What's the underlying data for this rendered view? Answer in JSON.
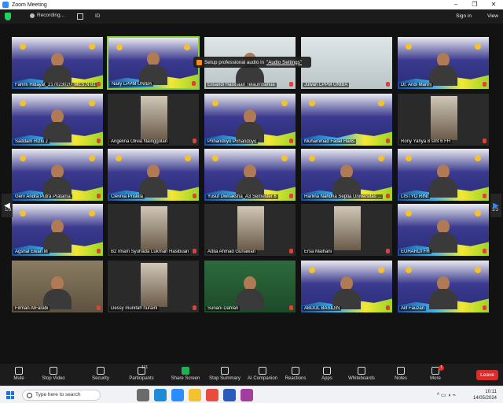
{
  "window": {
    "title": "Zoom Meeting",
    "controls": [
      "–",
      "❐",
      "✕"
    ]
  },
  "topbar": {
    "recording": "Recording...",
    "meeting_id_label": "ID",
    "signin": "Sign in",
    "view": "View"
  },
  "toast": {
    "text": "Setup professional audio in ",
    "link": "\"Audio Settings\""
  },
  "pagination": {
    "left": "1/3",
    "right": "1/3"
  },
  "participants": [
    "Fahmi Hidayat_217023020_MES.N 81",
    "Naily LPPM UNIBA",
    "Elisandi Hasloaan Telaumbanua",
    "Juwari LPPM UNIBA",
    "Dr. Andi Marini",
    "Saddam Rizki J",
    "Angelina Olivia Nainggolan",
    "Prihandoyo Prihandoyo",
    "Muhammad Fadel Haris",
    "Rony Yahya 8 smt 6 FH",
    "Gerv Andra Putra Pratama",
    "Clevnia Priskila",
    "Yusuf Dwiraksha_A3 Semester 6",
    "Harlina Nahdha Septia Universitas ...",
    "LISTYO RINI",
    "Agshal Ewan M",
    "B2 Imam Syuhada Lukman Hasibuan",
    "Attila Ahmad Gunawan",
    "Ersa Maihani",
    "EUHARDI FH",
    "Firman AlFarabi",
    "Dessy munifah nuraini",
    "Suriani Dahlan",
    "ABDUL BASIDIN",
    "Alif Fauzan"
  ],
  "banner": {
    "line1": "GELOMBANG XVI SEMESTER GANJIL TAHUN 2024/2025",
    "line2": "14 MAY 2024, BALIKPAPAN"
  },
  "toolbar": {
    "mute": "Mute",
    "video": "Stop Video",
    "security": "Security",
    "participants": "Participants",
    "participants_count": "111",
    "share": "Share Screen",
    "summary": "Stop Summary",
    "ai": "AI Companion",
    "reactions": "Reactions",
    "apps": "Apps",
    "whiteboards": "Whiteboards",
    "notes": "Notes",
    "more": "More",
    "more_badge": "1",
    "leave": "Leave"
  },
  "taskbar": {
    "search": "Type here to search",
    "time": "10:11",
    "date": "14/05/2024"
  }
}
